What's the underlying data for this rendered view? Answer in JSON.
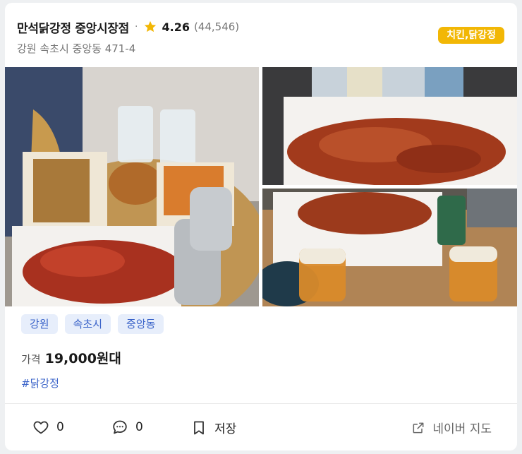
{
  "store": {
    "name": "만석닭강정 중앙시장점",
    "separator": "·",
    "rating": "4.26",
    "review_count": "(44,546)",
    "address": "강원 속초시 중앙동 471-4",
    "category": "치킨,닭강정"
  },
  "tags": [
    "강원",
    "속초시",
    "중앙동"
  ],
  "price": {
    "label": "가격",
    "value": "19,000원대"
  },
  "hashtag": "#닭강정",
  "actions": {
    "like_count": "0",
    "comment_count": "0",
    "save_label": "저장",
    "naver_map_label": "네이버 지도"
  },
  "colors": {
    "category_badge": "#f2b705",
    "star": "#f2b705",
    "tag_bg": "#e7eefb",
    "tag_text": "#3a63c9"
  }
}
